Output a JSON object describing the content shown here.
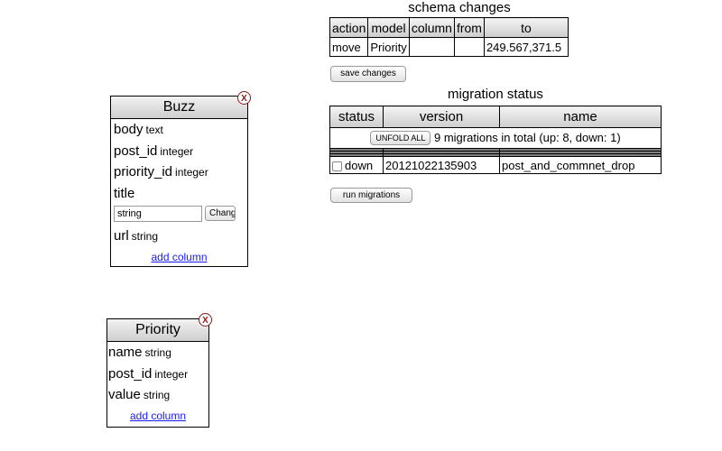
{
  "schema_changes": {
    "title": "schema changes",
    "headers": [
      "action",
      "model",
      "column",
      "from",
      "to"
    ],
    "rows": [
      [
        "move",
        "Priority",
        "",
        "",
        "249.567,371.5"
      ]
    ],
    "save_button": "save changes"
  },
  "migration_status": {
    "title": "migration status",
    "headers": [
      "status",
      "version",
      "name"
    ],
    "unfold_button": "UNFOLD ALL",
    "summary": "9 migrations in total (up: 8, down: 1)",
    "row": {
      "status": "down",
      "version": "20121022135903",
      "name": "post_and_commnet_drop"
    },
    "run_button": "run migrations"
  },
  "models": {
    "buzz": {
      "name": "Buzz",
      "close": "X",
      "columns": [
        {
          "name": "body",
          "type": "text"
        },
        {
          "name": "post_id",
          "type": "integer"
        },
        {
          "name": "priority_id",
          "type": "integer"
        },
        {
          "name": "title",
          "type": ""
        },
        {
          "name": "url",
          "type": "string"
        }
      ],
      "edit_value": "string",
      "edit_button": "Change",
      "add_column": "add column"
    },
    "priority": {
      "name": "Priority",
      "close": "X",
      "columns": [
        {
          "name": "name",
          "type": "string"
        },
        {
          "name": "post_id",
          "type": "integer"
        },
        {
          "name": "value",
          "type": "string"
        }
      ],
      "add_column": "add column"
    }
  }
}
